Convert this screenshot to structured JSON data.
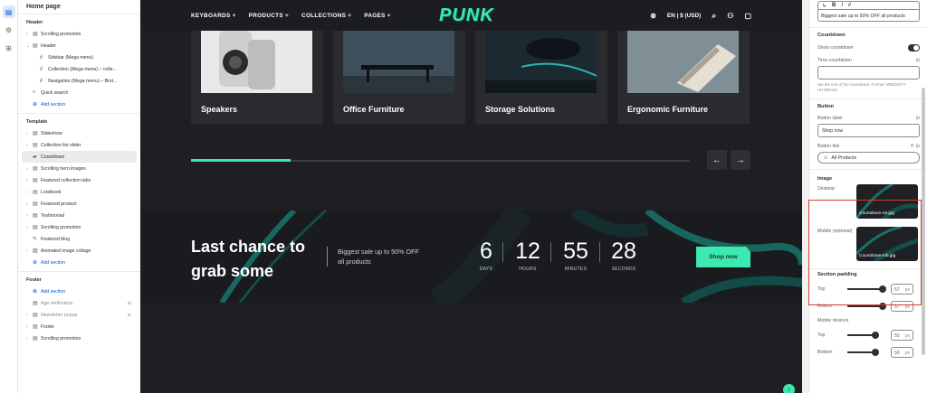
{
  "sidebar": {
    "title": "Home page",
    "header_group": {
      "title": "Header",
      "items": [
        {
          "label": "Scrolling promotion",
          "kind": "section"
        },
        {
          "label": "Header",
          "kind": "section"
        },
        {
          "label": "Sidebar (Mega menu)",
          "kind": "block"
        },
        {
          "label": "Collection (Mega menu) – colle...",
          "kind": "block"
        },
        {
          "label": "Navigation (Mega menu) – Brot...",
          "kind": "block"
        },
        {
          "label": "Quick search",
          "kind": "block-top"
        }
      ],
      "add_label": "Add section"
    },
    "template_group": {
      "title": "Template",
      "items": [
        {
          "label": "Slideshow"
        },
        {
          "label": "Collection list slider"
        },
        {
          "label": "Countdown",
          "active": true
        },
        {
          "label": "Scrolling hero images"
        },
        {
          "label": "Featured collection tabs"
        },
        {
          "label": "Lookbook"
        },
        {
          "label": "Featured product"
        },
        {
          "label": "Testimonial"
        },
        {
          "label": "Scrolling promotion"
        },
        {
          "label": "Featured blog"
        },
        {
          "label": "Animated image collage"
        }
      ],
      "add_label": "Add section"
    },
    "footer_group": {
      "title": "Footer",
      "add_label": "Add section",
      "items": [
        {
          "label": "Age verification",
          "hidden": true
        },
        {
          "label": "Newsletter popup",
          "hidden": true
        },
        {
          "label": "Footer"
        },
        {
          "label": "Scrolling promotion"
        }
      ]
    }
  },
  "preview": {
    "nav": [
      "KEYBOARDS +",
      "PRODUCTS +",
      "COLLECTIONS +",
      "PAGES +"
    ],
    "logo": "PUNK",
    "locale": "EN | $ (USD)",
    "cards": [
      "Speakers",
      "Office Furniture",
      "Storage Solutions",
      "Ergonomic Furniture"
    ],
    "slider_progress": 0.2,
    "banner": {
      "title": "Last chance to grab some",
      "subtitle": "Biggest sale up to 50% OFF all products",
      "countdown": [
        {
          "value": "6",
          "unit": "DAYS"
        },
        {
          "value": "12",
          "unit": "HOURS"
        },
        {
          "value": "55",
          "unit": "MINUTES"
        },
        {
          "value": "28",
          "unit": "SECONDS"
        }
      ],
      "button": "Shop now"
    },
    "accent": "#3de9b0"
  },
  "inspector": {
    "richtext_value": "Biggest sale up to 50% OFF all products",
    "countdown": {
      "heading": "Countdown",
      "show_label": "Show countdown",
      "show_value": true,
      "time_label": "Time countdown",
      "time_value": "",
      "hint": "Set the end of the countdown. Format: MM/DD/YY HH:MM:SS"
    },
    "button": {
      "heading": "Button",
      "label_label": "Button label",
      "label_value": "Shop now",
      "link_label": "Button link",
      "link_value": "All Products"
    },
    "image": {
      "heading": "Image",
      "desktop_label": "Desktop",
      "desktop_file": "Countdown-04.jpg",
      "mobile_label": "Mobile (optional)",
      "mobile_file": "Countdown-mb.jpg"
    },
    "padding": {
      "heading": "Section padding",
      "top_label": "Top",
      "top_value": "57",
      "bottom_label": "Bottom",
      "bottom_value": "57",
      "mobile_heading": "Mobile devices",
      "m_top_label": "Top",
      "m_top_value": "50",
      "m_bottom_label": "Bottom",
      "m_bottom_value": "50",
      "unit": "px"
    }
  }
}
